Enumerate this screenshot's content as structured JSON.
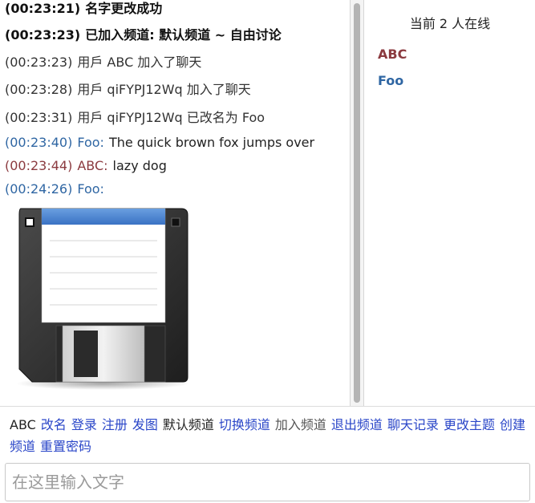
{
  "chat": {
    "messages": [
      {
        "time": "(00:23:21)",
        "text": "名字更改成功",
        "kind": "bold"
      },
      {
        "time": "(00:23:23)",
        "text": "已加入频道: 默认频道 ~ 自由讨论",
        "kind": "bold"
      },
      {
        "time": "(00:23:23)",
        "text": "用戶 ABC 加入了聊天",
        "kind": "system"
      },
      {
        "time": "(00:23:28)",
        "text": "用戶 qiFYPJ12Wq 加入了聊天",
        "kind": "system"
      },
      {
        "time": "(00:23:31)",
        "text": "用戶 qiFYPJ12Wq 已改名为 Foo",
        "kind": "system"
      },
      {
        "time": "(00:23:40)",
        "user": "Foo:",
        "text": "The quick brown fox jumps over",
        "kind": "chat",
        "color": "#2f66a3"
      },
      {
        "time": "(00:23:44)",
        "user": "ABC:",
        "text": "lazy dog",
        "kind": "chat",
        "color": "#8b3a3f"
      },
      {
        "time": "(00:24:26)",
        "user": "Foo:",
        "text": "",
        "kind": "image",
        "color": "#2f66a3",
        "image": "floppy-disk-icon"
      }
    ]
  },
  "online": {
    "count_label": "当前 2 人在线",
    "users": [
      {
        "name": "ABC",
        "color": "#8b3a3f"
      },
      {
        "name": "Foo",
        "color": "#2f66a3"
      }
    ]
  },
  "menu": {
    "current_user": "ABC",
    "items": [
      {
        "label": "改名",
        "type": "link"
      },
      {
        "label": "登录",
        "type": "link"
      },
      {
        "label": "注册",
        "type": "link"
      },
      {
        "label": "发图",
        "type": "link"
      },
      {
        "label": "默认频道",
        "type": "plain"
      },
      {
        "label": "切换频道",
        "type": "link"
      },
      {
        "label": "加入频道",
        "type": "muted"
      },
      {
        "label": "退出频道",
        "type": "link"
      },
      {
        "label": "聊天记录",
        "type": "link"
      },
      {
        "label": "更改主题",
        "type": "link"
      },
      {
        "label": "创建频道",
        "type": "link"
      },
      {
        "label": "重置密码",
        "type": "link"
      }
    ]
  },
  "input": {
    "placeholder": "在这里输入文字",
    "value": ""
  },
  "colors": {
    "link": "#2a46c8",
    "user_abc": "#8b3a3f",
    "user_foo": "#2f66a3"
  }
}
